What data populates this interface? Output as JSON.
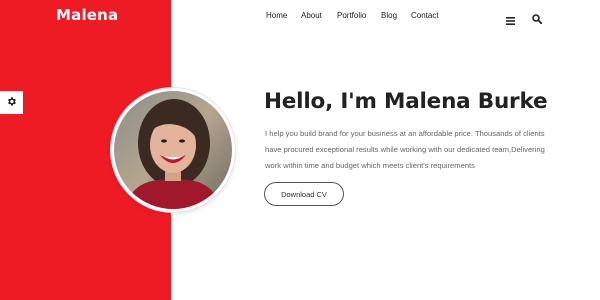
{
  "brand": {
    "logo_text": "Malena",
    "accent_color": "#ef1b24"
  },
  "nav": {
    "items": [
      {
        "label": "Home"
      },
      {
        "label": "About"
      },
      {
        "label": "Portfolio"
      },
      {
        "label": "Blog"
      },
      {
        "label": "Contact"
      }
    ],
    "menu_icon": "hamburger-menu-icon",
    "search_icon": "search-icon"
  },
  "settings": {
    "icon": "gear-icon"
  },
  "hero": {
    "headline": "Hello, I'm Malena Burke",
    "bio_lines": [
      "I help you build brand for your business at an affordable price. Thousands of clients",
      "have procured exceptional results while working with our dedicated team,Delivering",
      "work within time and budget which meets client's requirements"
    ],
    "cta_label": "Download CV"
  }
}
